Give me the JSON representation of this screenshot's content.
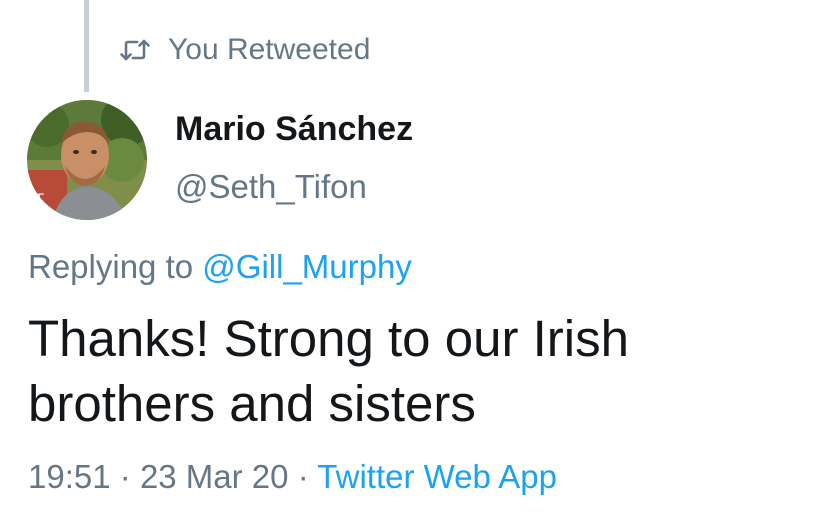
{
  "retweet": {
    "icon": "retweet-icon",
    "label": "You Retweeted"
  },
  "author": {
    "display_name": "Mario Sánchez",
    "handle": "@Seth_Tifon",
    "avatar": "profile-photo"
  },
  "reply": {
    "prefix": "Replying to",
    "mention": "@Gill_Murphy"
  },
  "tweet": {
    "line1": "Thanks! Strong to our Irish",
    "line2": "brothers and sisters"
  },
  "meta": {
    "time": "19:51",
    "separator": "·",
    "date": "23 Mar 20",
    "source": "Twitter Web App"
  },
  "colors": {
    "text": "#14171a",
    "secondary": "#657786",
    "link": "#1da1f2",
    "thread_line": "#c4cfd6"
  }
}
